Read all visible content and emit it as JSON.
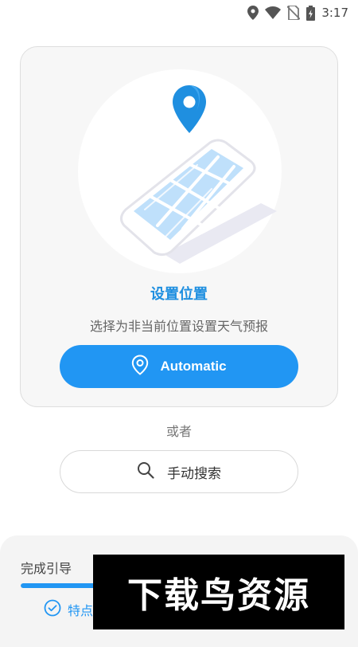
{
  "status_bar": {
    "time": "3:17",
    "icons": [
      "location-icon",
      "wifi-icon",
      "no-sim-icon",
      "battery-charging-icon"
    ]
  },
  "setup_card": {
    "title": "设置位置",
    "subtitle": "选择为非当前位置设置天气预报",
    "illustration": "phone-map-pin-illustration",
    "automatic_button": {
      "label": "Automatic",
      "icon": "location-pin-icon"
    }
  },
  "or_text": "或者",
  "manual_search": {
    "label": "手动搜索",
    "icon": "search-icon"
  },
  "guide": {
    "title": "完成引导",
    "progress": 0.25,
    "item_label": "特点",
    "item_icon": "check-circle-icon"
  },
  "watermark": {
    "text": "下载鸟资源"
  },
  "colors": {
    "accent": "#2196f3",
    "title_blue": "#1f8fe0",
    "card_background": "#f7f7f7",
    "watermark_background": "#000000"
  }
}
